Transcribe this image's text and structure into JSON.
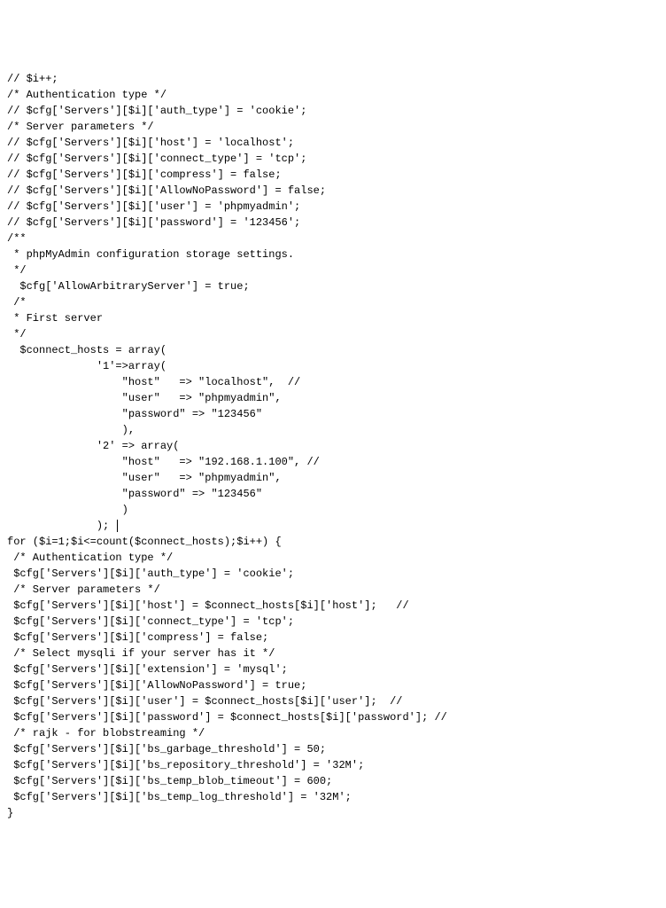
{
  "lines": [
    "// $i++;",
    "/* Authentication type */",
    "// $cfg['Servers'][$i]['auth_type'] = 'cookie';",
    "/* Server parameters */",
    "// $cfg['Servers'][$i]['host'] = 'localhost';",
    "// $cfg['Servers'][$i]['connect_type'] = 'tcp';",
    "// $cfg['Servers'][$i]['compress'] = false;",
    "// $cfg['Servers'][$i]['AllowNoPassword'] = false;",
    "// $cfg['Servers'][$i]['user'] = 'phpmyadmin';",
    "// $cfg['Servers'][$i]['password'] = '123456';",
    "/**",
    " * phpMyAdmin configuration storage settings.",
    " */",
    "  $cfg['AllowArbitraryServer'] = true;",
    " /*",
    " * First server",
    " */",
    "  $connect_hosts = array(",
    "              '1'=>array(",
    "                  \"host\"   => \"localhost\",  //",
    "                  \"user\"   => \"phpmyadmin\",",
    "                  \"password\" => \"123456\"",
    "                  ),",
    "              '2' => array(",
    "                  \"host\"   => \"192.168.1.100\", //",
    "                  \"user\"   => \"phpmyadmin\",",
    "                  \"password\" => \"123456\"",
    "                  )",
    "              ); ",
    "for ($i=1;$i<=count($connect_hosts);$i++) {",
    " /* Authentication type */",
    " $cfg['Servers'][$i]['auth_type'] = 'cookie';",
    " /* Server parameters */",
    " $cfg['Servers'][$i]['host'] = $connect_hosts[$i]['host'];   //",
    " $cfg['Servers'][$i]['connect_type'] = 'tcp';",
    " $cfg['Servers'][$i]['compress'] = false;",
    " /* Select mysqli if your server has it */",
    " $cfg['Servers'][$i]['extension'] = 'mysql';",
    " $cfg['Servers'][$i]['AllowNoPassword'] = true;",
    " $cfg['Servers'][$i]['user'] = $connect_hosts[$i]['user'];  //",
    " $cfg['Servers'][$i]['password'] = $connect_hosts[$i]['password']; //",
    " /* rajk - for blobstreaming */",
    " $cfg['Servers'][$i]['bs_garbage_threshold'] = 50;",
    " $cfg['Servers'][$i]['bs_repository_threshold'] = '32M';",
    " $cfg['Servers'][$i]['bs_temp_blob_timeout'] = 600;",
    " $cfg['Servers'][$i]['bs_temp_log_threshold'] = '32M';",
    "}"
  ],
  "cursor_line_index": 28
}
